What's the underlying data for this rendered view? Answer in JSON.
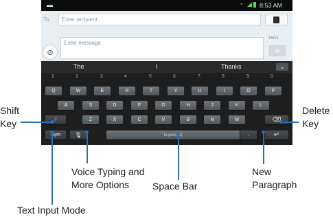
{
  "statusbar": {
    "time": "8:53 AM"
  },
  "compose": {
    "to_label": "To",
    "recipient_placeholder": "Enter recipient",
    "message_placeholder": "Enter message",
    "char_count": "160/1"
  },
  "suggestions": [
    "The",
    "I",
    "Thanks"
  ],
  "keyboard": {
    "numbers": [
      "1",
      "2",
      "3",
      "4",
      "5",
      "6",
      "7",
      "8",
      "9",
      "0"
    ],
    "row1": [
      "Q",
      "W",
      "E",
      "R",
      "T",
      "Y",
      "U",
      "I",
      "O",
      "P"
    ],
    "row2": [
      "A",
      "S",
      "D",
      "F",
      "G",
      "H",
      "J",
      "K",
      "L"
    ],
    "row3": [
      "Z",
      "X",
      "C",
      "V",
      "B",
      "N",
      "M"
    ],
    "sym_label": "Sym",
    "space_label": "English(US)",
    "dot_label": "."
  },
  "callouts": {
    "shift_key": "Shift Key",
    "delete_key": "Delete Key",
    "voice_typing": "Voice Typing and More Options",
    "space_bar": "Space Bar",
    "new_paragraph": "New Paragraph",
    "text_input_mode": "Text Input Mode"
  },
  "colors": {
    "callout_line": "#2a6fb5",
    "keyboard_bg": "#1e1e1e",
    "key": "#5f666a"
  }
}
